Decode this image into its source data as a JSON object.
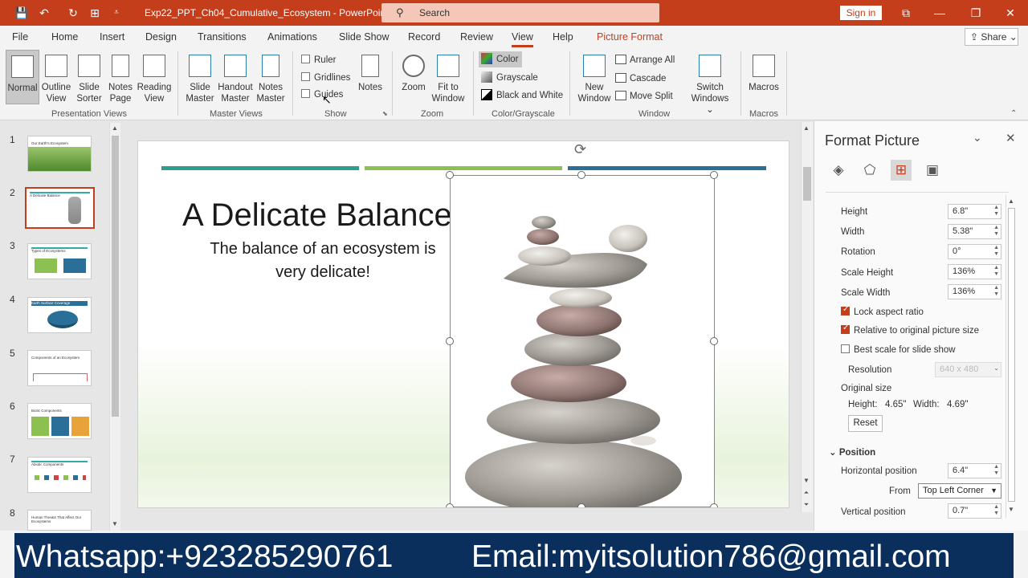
{
  "titlebar": {
    "doc_title": "Exp22_PPT_Ch04_Cumulative_Ecosystem  -  PowerPoint",
    "search_placeholder": "Search",
    "signin": "Sign in"
  },
  "tabs": [
    "File",
    "Home",
    "Insert",
    "Design",
    "Transitions",
    "Animations",
    "Slide Show",
    "Record",
    "Review",
    "View",
    "Help",
    "Picture Format"
  ],
  "share": "Share",
  "ribbon": {
    "presentation_views": {
      "label": "Presentation Views",
      "normal": "Normal",
      "outline": [
        "Outline",
        "View"
      ],
      "sorter": [
        "Slide",
        "Sorter"
      ],
      "notes_page": [
        "Notes",
        "Page"
      ],
      "reading": [
        "Reading",
        "View"
      ]
    },
    "master_views": {
      "label": "Master Views",
      "slide_master": [
        "Slide",
        "Master"
      ],
      "handout_master": [
        "Handout",
        "Master"
      ],
      "notes_master": [
        "Notes",
        "Master"
      ]
    },
    "show": {
      "label": "Show",
      "ruler": "Ruler",
      "gridlines": "Gridlines",
      "guides": "Guides",
      "notes": "Notes"
    },
    "zoom": {
      "label": "Zoom",
      "zoom": "Zoom",
      "fit": [
        "Fit to",
        "Window"
      ]
    },
    "color_grayscale": {
      "label": "Color/Grayscale",
      "color": "Color",
      "grayscale": "Grayscale",
      "bw": "Black and White"
    },
    "window": {
      "label": "Window",
      "new_window": [
        "New",
        "Window"
      ],
      "arrange_all": "Arrange All",
      "cascade": "Cascade",
      "move_split": "Move Split",
      "switch": [
        "Switch",
        "Windows ⌄"
      ]
    },
    "macros": {
      "label": "Macros",
      "macros": "Macros"
    }
  },
  "thumbnails": [
    {
      "num": "1",
      "title": "Our Earth's Ecosystem"
    },
    {
      "num": "2",
      "title": "A Delicate Balance"
    },
    {
      "num": "3",
      "title": "Types of Ecosystems"
    },
    {
      "num": "4",
      "title": "Earth Surface Coverage"
    },
    {
      "num": "5",
      "title": "Components of an Ecosystem"
    },
    {
      "num": "6",
      "title": "Biotic Components"
    },
    {
      "num": "7",
      "title": "Abiotic Components"
    },
    {
      "num": "8",
      "title": "Human Threats That Affect Our Ecosystems"
    }
  ],
  "slide": {
    "title": "A Delicate Balance",
    "subtitle": "The balance of an ecosystem is very delicate!"
  },
  "format_pane": {
    "title": "Format Picture",
    "height_label": "Height",
    "height_value": "6.8\"",
    "width_label": "Width",
    "width_value": "5.38\"",
    "rotation_label": "Rotation",
    "rotation_value": "0°",
    "scale_height_label": "Scale Height",
    "scale_height_value": "136%",
    "scale_width_label": "Scale Width",
    "scale_width_value": "136%",
    "lock_aspect": "Lock aspect ratio",
    "relative_original": "Relative to original picture size",
    "best_scale": "Best scale for slide show",
    "resolution_label": "Resolution",
    "resolution_value": "640 x 480",
    "original_size": "Original size",
    "orig_height_label": "Height:",
    "orig_height_value": "4.65\"",
    "orig_width_label": "Width:",
    "orig_width_value": "4.69\"",
    "reset": "Reset",
    "position_header": "Position",
    "horizontal_label": "Horizontal position",
    "horizontal_value": "6.4\"",
    "from_label": "From",
    "from_value": "Top Left Corner",
    "vertical_label": "Vertical position",
    "vertical_value": "0.7\""
  },
  "banner": {
    "whatsapp": "Whatsapp:+923285290761",
    "email": "Email:myitsolution786@gmail.com"
  },
  "colors": {
    "accent": "#c43e1c",
    "teal_bar": "#2e9e8e",
    "green_bar": "#8cc152",
    "blue_bar": "#2a6f97",
    "banner_bg": "#0a2f5c"
  }
}
